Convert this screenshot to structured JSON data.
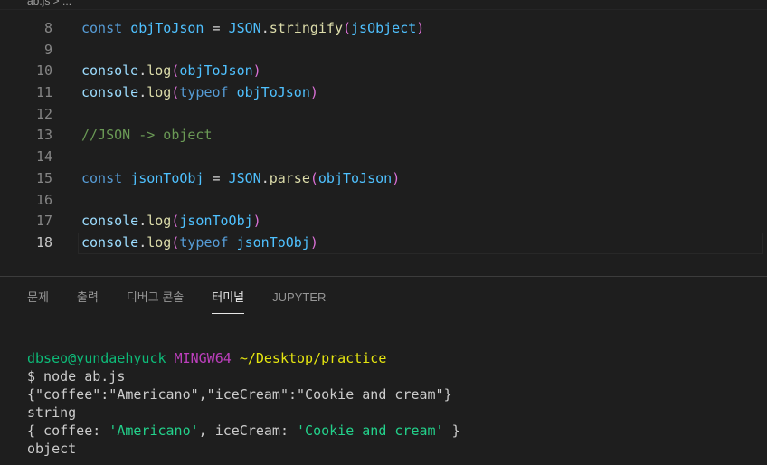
{
  "breadcrumb": "ab.js > ...",
  "editor": {
    "lines": [
      {
        "num": "8",
        "parts": [
          {
            "c": "kw",
            "t": "const "
          },
          {
            "c": "var",
            "t": "objToJson"
          },
          {
            "c": "pn",
            "t": " = "
          },
          {
            "c": "var",
            "t": "JSON"
          },
          {
            "c": "pn",
            "t": "."
          },
          {
            "c": "fn",
            "t": "stringify"
          },
          {
            "c": "br",
            "t": "("
          },
          {
            "c": "var",
            "t": "jsObject"
          },
          {
            "c": "br",
            "t": ")"
          }
        ]
      },
      {
        "num": "9",
        "parts": []
      },
      {
        "num": "10",
        "parts": [
          {
            "c": "obj",
            "t": "console"
          },
          {
            "c": "pn",
            "t": "."
          },
          {
            "c": "fn",
            "t": "log"
          },
          {
            "c": "br",
            "t": "("
          },
          {
            "c": "var",
            "t": "objToJson"
          },
          {
            "c": "br",
            "t": ")"
          }
        ]
      },
      {
        "num": "11",
        "parts": [
          {
            "c": "obj",
            "t": "console"
          },
          {
            "c": "pn",
            "t": "."
          },
          {
            "c": "fn",
            "t": "log"
          },
          {
            "c": "br",
            "t": "("
          },
          {
            "c": "kw",
            "t": "typeof "
          },
          {
            "c": "var",
            "t": "objToJson"
          },
          {
            "c": "br",
            "t": ")"
          }
        ]
      },
      {
        "num": "12",
        "parts": []
      },
      {
        "num": "13",
        "parts": [
          {
            "c": "cm",
            "t": "//JSON -> object"
          }
        ]
      },
      {
        "num": "14",
        "parts": []
      },
      {
        "num": "15",
        "parts": [
          {
            "c": "kw",
            "t": "const "
          },
          {
            "c": "var",
            "t": "jsonToObj"
          },
          {
            "c": "pn",
            "t": " = "
          },
          {
            "c": "var",
            "t": "JSON"
          },
          {
            "c": "pn",
            "t": "."
          },
          {
            "c": "fn",
            "t": "parse"
          },
          {
            "c": "br",
            "t": "("
          },
          {
            "c": "var",
            "t": "objToJson"
          },
          {
            "c": "br",
            "t": ")"
          }
        ]
      },
      {
        "num": "16",
        "parts": []
      },
      {
        "num": "17",
        "parts": [
          {
            "c": "obj",
            "t": "console"
          },
          {
            "c": "pn",
            "t": "."
          },
          {
            "c": "fn",
            "t": "log"
          },
          {
            "c": "br",
            "t": "("
          },
          {
            "c": "var",
            "t": "jsonToObj"
          },
          {
            "c": "br",
            "t": ")"
          }
        ]
      },
      {
        "num": "18",
        "active": true,
        "parts": [
          {
            "c": "obj",
            "t": "console"
          },
          {
            "c": "pn",
            "t": "."
          },
          {
            "c": "fn",
            "t": "log"
          },
          {
            "c": "br",
            "t": "("
          },
          {
            "c": "kw",
            "t": "typeof "
          },
          {
            "c": "var",
            "t": "jsonToObj"
          },
          {
            "c": "br",
            "t": ")"
          }
        ]
      }
    ]
  },
  "panel": {
    "tabs": [
      {
        "label": "문제"
      },
      {
        "label": "출력"
      },
      {
        "label": "디버그 콘솔"
      },
      {
        "label": "터미널",
        "active": true
      },
      {
        "label": "JUPYTER"
      }
    ]
  },
  "terminal": {
    "prompt_user": "dbseo@yundaehyuck",
    "prompt_env": "MINGW64",
    "prompt_path": "~/Desktop/practice",
    "command": "$ node ab.js",
    "out_json": "{\"coffee\":\"Americano\",\"iceCream\":\"Cookie and cream\"}",
    "out_type1": "string",
    "out_obj_open": "{ coffee: ",
    "out_obj_val1": "'Americano'",
    "out_obj_mid": ", iceCream: ",
    "out_obj_val2": "'Cookie and cream'",
    "out_obj_close": " }",
    "out_type2": "object"
  },
  "colors": {
    "background": "#1e1e1e",
    "keyword": "#569cd6",
    "function": "#dcdcaa",
    "comment": "#6a9955",
    "terminal_user": "#0dbc79",
    "terminal_env": "#bc3fbc",
    "terminal_path": "#e5e510",
    "terminal_string": "#23d18b"
  }
}
